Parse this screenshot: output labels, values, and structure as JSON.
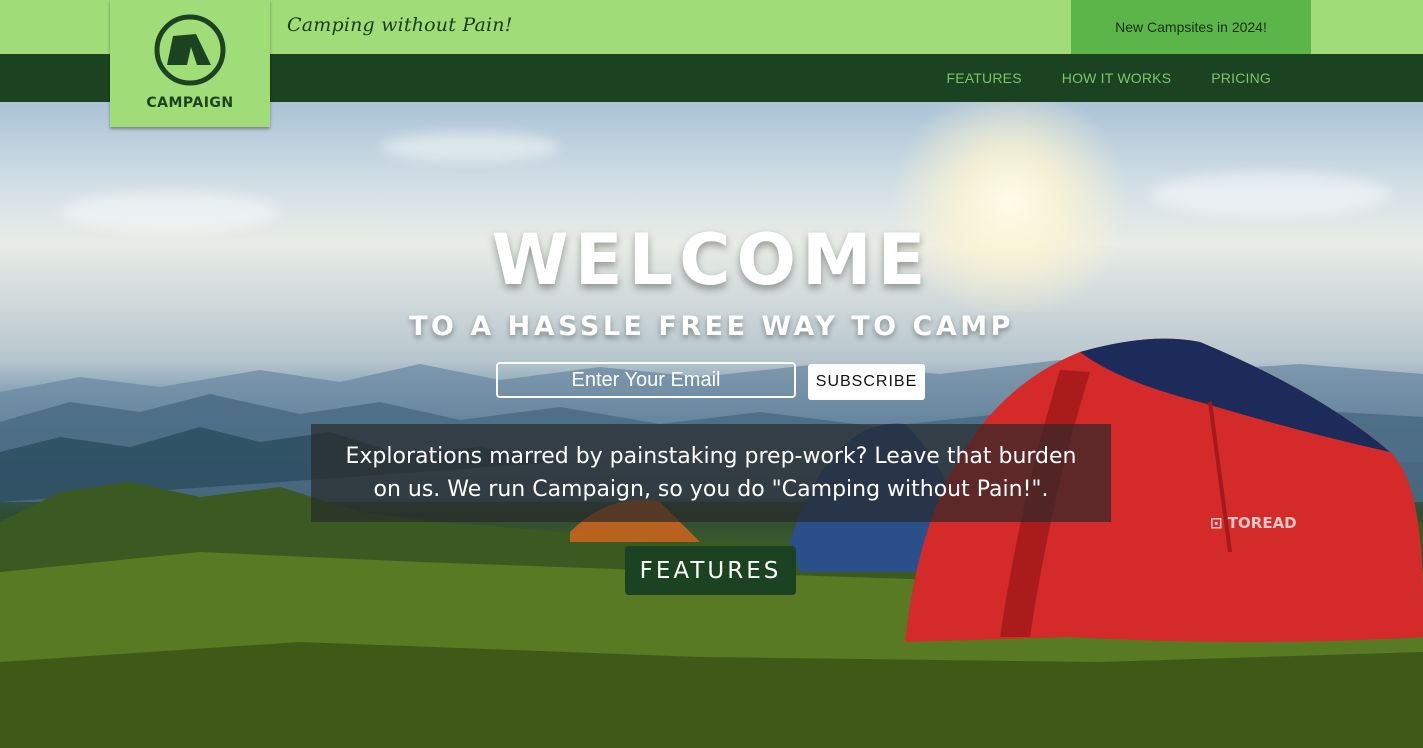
{
  "topbar": {
    "tagline": "Camping without Pain!",
    "promo": "New Campsites in 2024!"
  },
  "logo": {
    "icon": "tent-icon",
    "name": "CAMPAIGN"
  },
  "nav": {
    "links": [
      "FEATURES",
      "HOW IT WORKS",
      "PRICING"
    ]
  },
  "hero": {
    "title": "WELCOME",
    "subtitle": "TO A HASSLE FREE WAY TO CAMP",
    "email_placeholder": "Enter Your Email",
    "subscribe_label": "SUBSCRIBE",
    "description": "Explorations marred by painstaking prep-work? Leave that burden on us. We run Campaign, so you do \"Camping without Pain!\".",
    "features_button": "FEATURES"
  },
  "colors": {
    "topbar": "#a0dc78",
    "promo": "#5cb548",
    "navbar": "#1c4321",
    "nav_link": "#7cc46a",
    "tent_red": "#d42a2a"
  }
}
